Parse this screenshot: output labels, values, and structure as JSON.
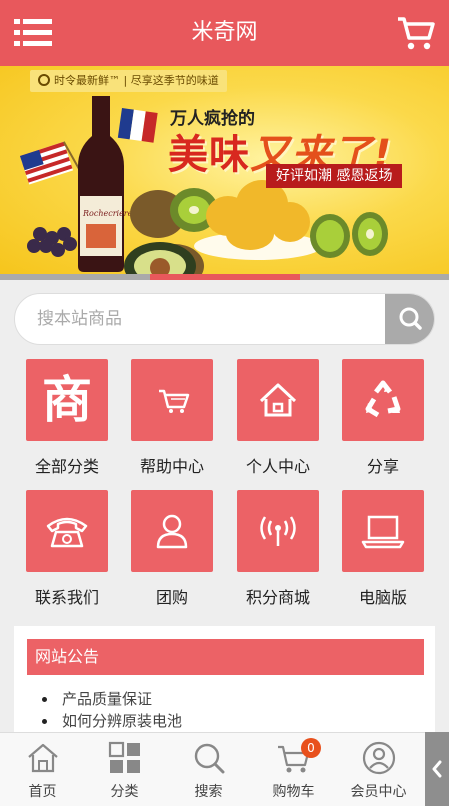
{
  "header": {
    "title": "米奇网",
    "menu_icon": "menu-icon",
    "cart_icon": "cart-icon",
    "color": "#e8585c"
  },
  "banner": {
    "tag_text": "时令最新鲜™ | 尽享这季节的味道",
    "headline_top": "万人疯抢的",
    "headline_main_1": "美味",
    "headline_main_2": "又来了!",
    "headline_sub": "好评如潮 感恩返场",
    "wine_label": "Rochecriere"
  },
  "search": {
    "placeholder": "搜本站商品",
    "button_icon": "search-icon"
  },
  "grid": [
    {
      "label": "全部分类",
      "icon": "shop-char-icon",
      "glyph": "商"
    },
    {
      "label": "帮助中心",
      "icon": "cart-icon"
    },
    {
      "label": "个人中心",
      "icon": "home-icon"
    },
    {
      "label": "分享",
      "icon": "recycle-icon"
    },
    {
      "label": "联系我们",
      "icon": "telephone-icon"
    },
    {
      "label": "团购",
      "icon": "user-icon"
    },
    {
      "label": "积分商城",
      "icon": "signal-icon"
    },
    {
      "label": "电脑版",
      "icon": "laptop-icon"
    }
  ],
  "notice": {
    "title": "网站公告",
    "items": [
      "产品质量保证",
      "如何分辨原装电池"
    ]
  },
  "bottom_nav": [
    {
      "label": "首页",
      "icon": "home-icon"
    },
    {
      "label": "分类",
      "icon": "grid-icon"
    },
    {
      "label": "搜索",
      "icon": "search-icon"
    },
    {
      "label": "购物车",
      "icon": "cart-icon",
      "badge": "0"
    },
    {
      "label": "会员中心",
      "icon": "user-icon"
    }
  ],
  "side_tab_icon": "chevron-left-icon",
  "colors": {
    "accent": "#ec6266",
    "badge": "#e8501c"
  }
}
